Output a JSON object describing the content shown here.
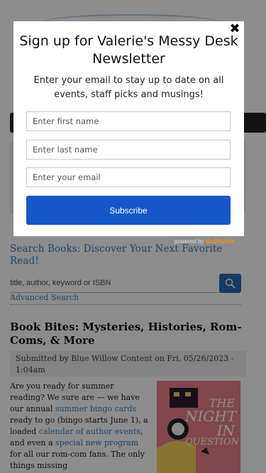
{
  "modal": {
    "title": "Sign up for Valerie's Messy Desk Newsletter",
    "description": "Enter your email to stay up to date on all events, staff picks and musings!",
    "first_name_placeholder": "Enter first name",
    "last_name_placeholder": "Enter last name",
    "email_placeholder": "Enter your email",
    "subscribe_label": "Subscribe",
    "close_glyph": "✖",
    "powered_by": "powered by",
    "powered_brand": "MailMunch"
  },
  "search": {
    "title": "Search Books: Discover Your Next Favorite Read!",
    "placeholder": "title, author, keyword or ISBN",
    "advanced": "Advanced Search",
    "button_icon": "search-icon"
  },
  "article": {
    "title": "Book Bites: Mysteries, Histories, Rom-Coms, & More",
    "submitted": "Submitted by Blue Willow Content on Fri, 05/26/2023 - 1:04am",
    "body": {
      "p1": "Are you ready for summer reading? We sure are — we have our annual ",
      "link1": "summer bingo cards",
      "p2": " ready to go (bingo starts June 1), a loaded ",
      "link2": "calendar of author events",
      "p3": ", and even a ",
      "link3": "special new program",
      "p4": " for all our rom-com fans. The only things missing"
    },
    "book_cover": {
      "title_line1": "THE",
      "title_line2": "NIGHT",
      "title_line3": "IN",
      "title_line4": "QUESTION"
    }
  },
  "colors": {
    "accent": "#3a7fc1",
    "button": "#1658c9",
    "brand": "#ff8c1a"
  }
}
